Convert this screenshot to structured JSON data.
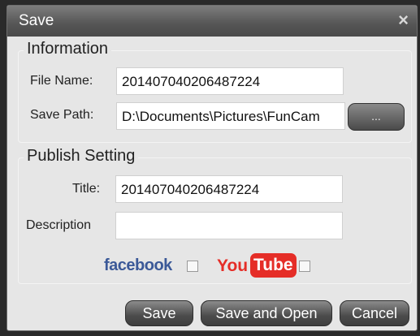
{
  "dialog": {
    "title": "Save",
    "close_glyph": "×"
  },
  "information": {
    "legend": "Information",
    "file_name_label": "File Name:",
    "file_name_value": "201407040206487224",
    "save_path_label": "Save Path:",
    "save_path_value": "D:\\Documents\\Pictures\\FunCam",
    "browse_label": "..."
  },
  "publish": {
    "legend": "Publish Setting",
    "title_label": "Title:",
    "title_value": "201407040206487224",
    "description_label": "Description",
    "description_value": "",
    "facebook_label": "facebook",
    "facebook_checked": false,
    "youtube_you": "You",
    "youtube_tube": "Tube",
    "youtube_checked": false,
    "facebook_color": "#3b5998",
    "youtube_color": "#e52d27"
  },
  "buttons": {
    "save": "Save",
    "save_and_open": "Save and Open",
    "cancel": "Cancel"
  }
}
